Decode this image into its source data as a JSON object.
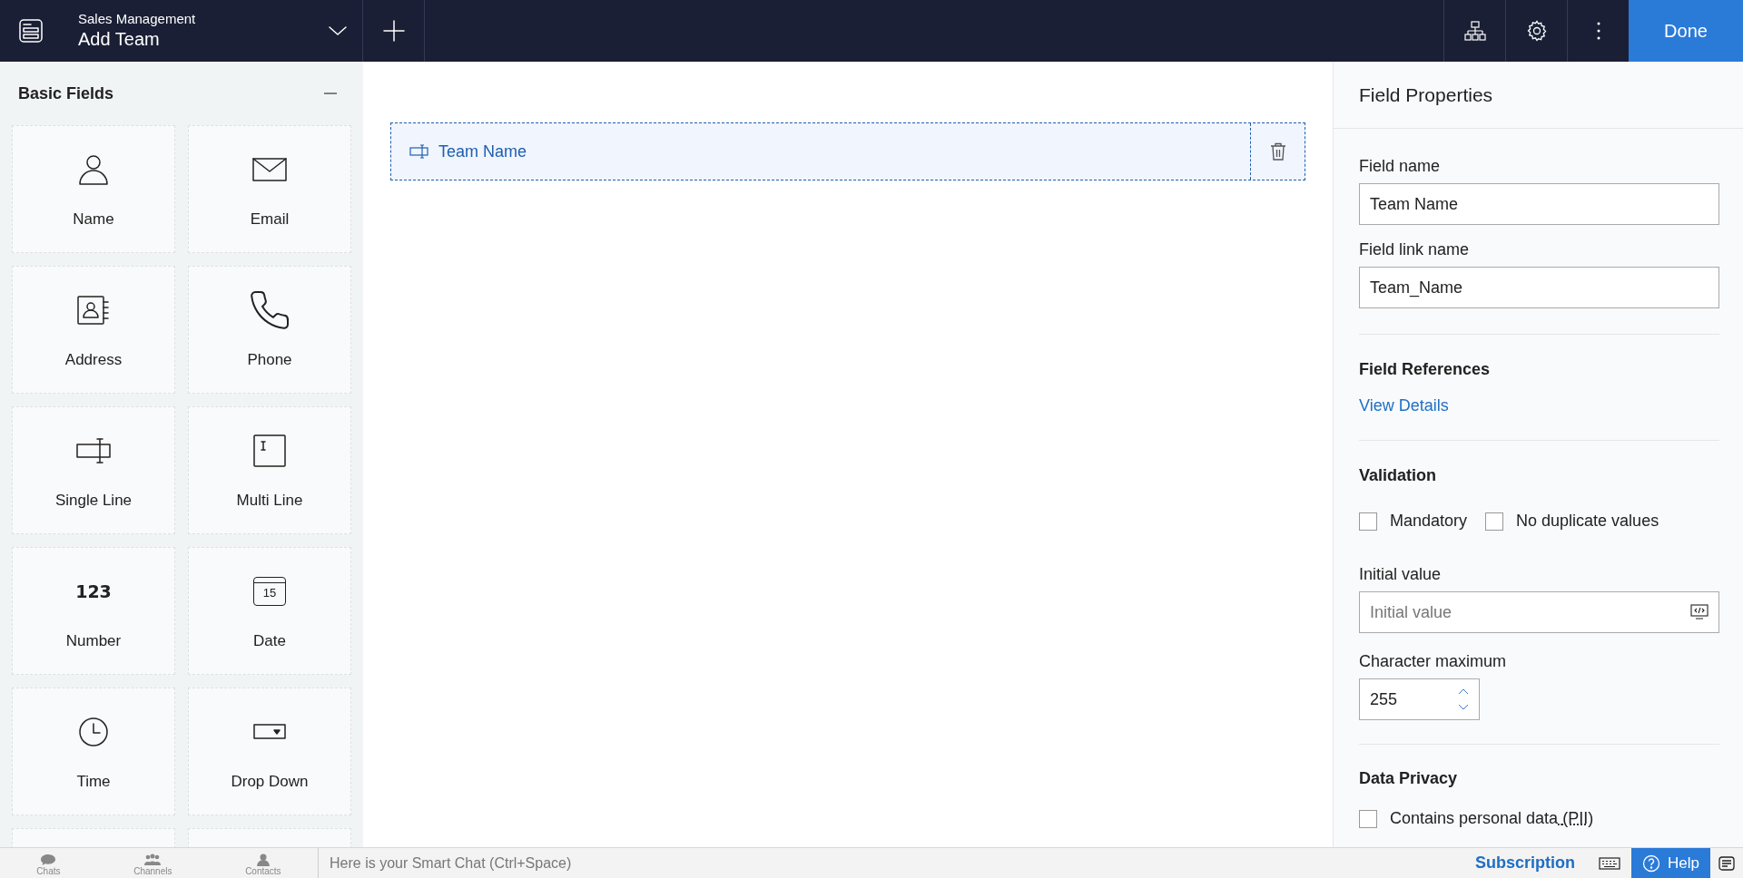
{
  "header": {
    "app_name": "Sales Management",
    "form_name": "Add Team",
    "done_button": "Done"
  },
  "palette": {
    "title": "Basic Fields",
    "expanded": true,
    "items": [
      {
        "label": "Name",
        "kind": "name"
      },
      {
        "label": "Email",
        "kind": "email"
      },
      {
        "label": "Address",
        "kind": "address"
      },
      {
        "label": "Phone",
        "kind": "phone"
      },
      {
        "label": "Single Line",
        "kind": "single_line"
      },
      {
        "label": "Multi Line",
        "kind": "multi_line"
      },
      {
        "label": "Number",
        "kind": "number",
        "glyph": "123"
      },
      {
        "label": "Date",
        "kind": "date",
        "glyph": "15"
      },
      {
        "label": "Time",
        "kind": "time"
      },
      {
        "label": "Drop Down",
        "kind": "dropdown"
      }
    ]
  },
  "canvas": {
    "fields": [
      {
        "label": "Team Name",
        "selected": true
      }
    ]
  },
  "properties": {
    "title": "Field Properties",
    "field_name": {
      "label": "Field name",
      "value": "Team Name"
    },
    "field_link_name": {
      "label": "Field link name",
      "value": "Team_Name"
    },
    "references": {
      "title": "Field References",
      "link": "View Details"
    },
    "validation": {
      "title": "Validation",
      "options": [
        {
          "label": "Mandatory",
          "checked": false
        },
        {
          "label": "No duplicate values",
          "checked": false
        }
      ]
    },
    "initial_value": {
      "label": "Initial value",
      "placeholder": "Initial value"
    },
    "char_max": {
      "label": "Character maximum",
      "value": "255"
    },
    "privacy": {
      "title": "Data Privacy",
      "options": [
        {
          "label": "Contains personal data",
          "abbr": "(PII)",
          "checked": false
        }
      ]
    }
  },
  "bottom_bar": {
    "tabs": [
      "Chats",
      "Channels",
      "Contacts"
    ],
    "chat_placeholder": "Here is your Smart Chat (Ctrl+Space)",
    "subscription": "Subscription",
    "help": "Help"
  }
}
